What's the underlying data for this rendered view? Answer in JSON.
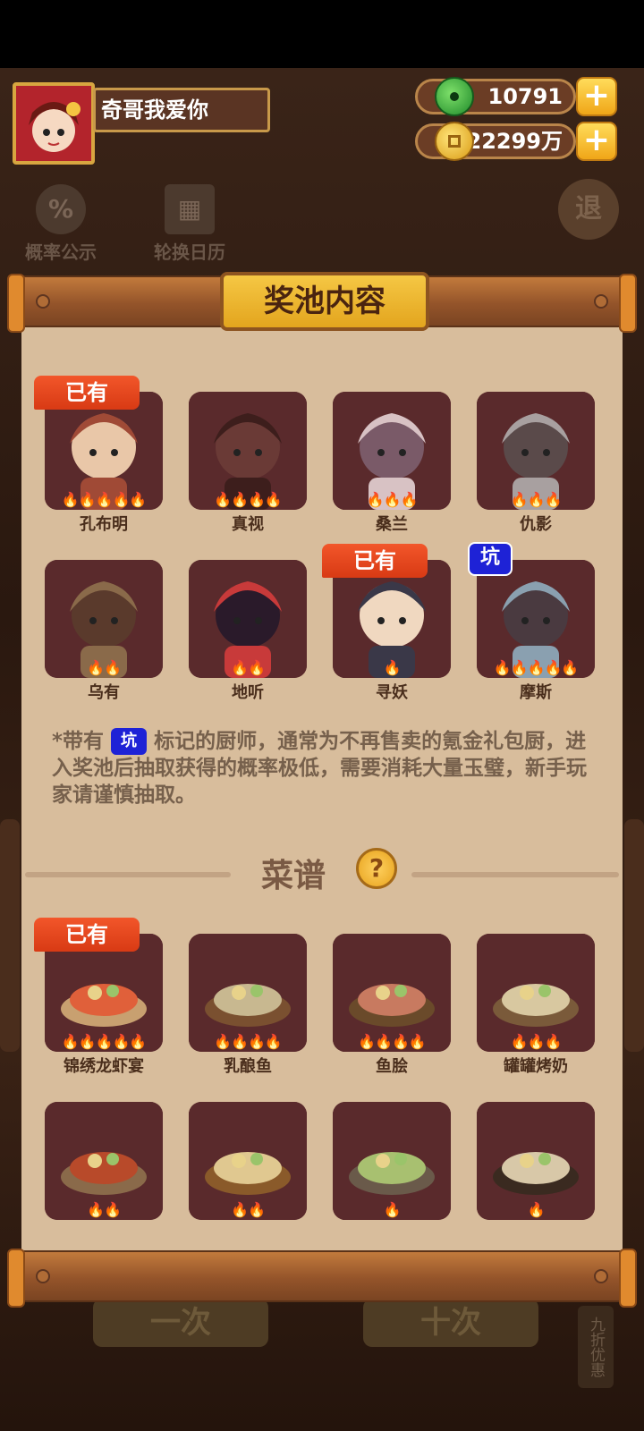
{
  "player": {
    "name": "奇哥我爱你"
  },
  "currencies": [
    {
      "name": "jade",
      "value": "10791",
      "icon": "jade-icon",
      "color": "#2fae3b"
    },
    {
      "name": "coins",
      "value": "22299万",
      "icon": "coin-icon",
      "color": "#f2b61f"
    }
  ],
  "background": {
    "tools": [
      "概率公示",
      "轮换日历"
    ],
    "exit": "退",
    "buttons": [
      "一次",
      "十次"
    ],
    "discount": "九折优惠"
  },
  "panel": {
    "title": "奖池内容",
    "owned_label": "已有",
    "pit_label": "坑",
    "chefs": [
      {
        "name": "孔布明",
        "fires": 5,
        "owned": true,
        "pit": false
      },
      {
        "name": "真视",
        "fires": 4,
        "owned": false,
        "pit": false
      },
      {
        "name": "桑兰",
        "fires": 3,
        "owned": false,
        "pit": false
      },
      {
        "name": "仇影",
        "fires": 3,
        "owned": false,
        "pit": false
      },
      {
        "name": "乌有",
        "fires": 2,
        "owned": false,
        "pit": false
      },
      {
        "name": "地听",
        "fires": 2,
        "owned": false,
        "pit": false
      },
      {
        "name": "寻妖",
        "fires": 1,
        "owned": true,
        "pit": false
      },
      {
        "name": "摩斯",
        "fires": 5,
        "owned": false,
        "pit": true
      }
    ],
    "note_prefix": "*带有",
    "note_text": "标记的厨师，通常为不再售卖的氪金礼包厨，进入奖池后抽取获得的概率极低，需要消耗大量玉璧，新手玩家请谨慎抽取。",
    "recipes_title": "菜谱",
    "help_icon": "?",
    "recipes": [
      {
        "name": "锦绣龙虾宴",
        "fires": 5,
        "owned": true
      },
      {
        "name": "乳酿鱼",
        "fires": 4,
        "owned": false
      },
      {
        "name": "鱼脍",
        "fires": 4,
        "owned": false
      },
      {
        "name": "罐罐烤奶",
        "fires": 3,
        "owned": false
      },
      {
        "name": "",
        "fires": 2,
        "owned": false
      },
      {
        "name": "",
        "fires": 2,
        "owned": false
      },
      {
        "name": "",
        "fires": 1,
        "owned": false
      },
      {
        "name": "",
        "fires": 1,
        "owned": false
      }
    ]
  }
}
